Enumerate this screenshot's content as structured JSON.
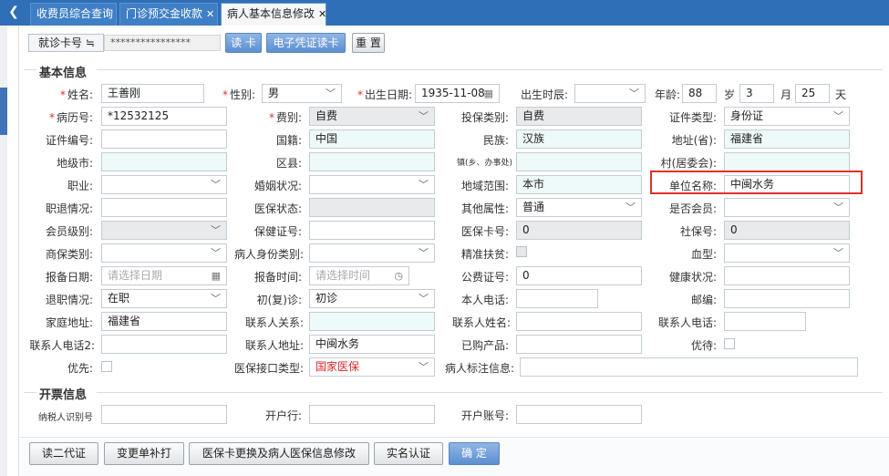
{
  "tabs": [
    {
      "label": "收费员综合查询",
      "closable": false,
      "active": false
    },
    {
      "label": "门诊预交金收款",
      "closable": true,
      "active": false
    },
    {
      "label": "病人基本信息修改",
      "closable": true,
      "active": true
    }
  ],
  "card": {
    "label": "就诊卡号 ≒",
    "value": "****************",
    "read_btn": "读 卡",
    "ecard_btn": "电子凭证读卡",
    "reset_btn": "重 置"
  },
  "sections": {
    "basic": "基本信息",
    "invoice": "开票信息"
  },
  "fields": {
    "name": {
      "label": "姓名:",
      "value": "王善刚"
    },
    "sex": {
      "label": "性别:",
      "value": "男"
    },
    "dob": {
      "label": "出生日期:",
      "value": "1935-11-08"
    },
    "birth_time": {
      "label": "出生时辰:",
      "value": ""
    },
    "age": {
      "label": "年龄:",
      "years": "88",
      "yl": "岁",
      "months": "3",
      "ml": "月",
      "days": "25",
      "dl": "天"
    },
    "record_no": {
      "label": "病历号:",
      "value": "*12532125"
    },
    "fee_type": {
      "label": "费别:",
      "value": "自费"
    },
    "ins_type": {
      "label": "投保类别:",
      "value": "自费"
    },
    "cert_type": {
      "label": "证件类型:",
      "value": "身份证"
    },
    "cert_no": {
      "label": "证件编号:",
      "value": ""
    },
    "nationality": {
      "label": "国籍:",
      "value": "中国"
    },
    "ethnic": {
      "label": "民族:",
      "value": "汉族"
    },
    "province": {
      "label": "地址(省):",
      "value": "福建省"
    },
    "city": {
      "label": "地级市:",
      "value": ""
    },
    "county": {
      "label": "区县:",
      "value": ""
    },
    "town": {
      "label": "镇(乡、办事处)",
      "value": ""
    },
    "village": {
      "label": "村(居委会):",
      "value": ""
    },
    "job": {
      "label": "职业:",
      "value": ""
    },
    "marital": {
      "label": "婚姻状况:",
      "value": ""
    },
    "region": {
      "label": "地域范围:",
      "value": "本市"
    },
    "employer": {
      "label": "单位名称:",
      "value": "中闽水务"
    },
    "title": {
      "label": "职退情况:",
      "value": ""
    },
    "ins_status": {
      "label": "医保状态:",
      "value": ""
    },
    "other_attr": {
      "label": "其他属性:",
      "value": "普通"
    },
    "is_member": {
      "label": "是否会员:",
      "value": ""
    },
    "member_level": {
      "label": "会员级别:",
      "value": ""
    },
    "health_no": {
      "label": "保健证号:",
      "value": ""
    },
    "ins_card": {
      "label": "医保卡号:",
      "value": "0"
    },
    "ss_no": {
      "label": "社保号:",
      "value": "0"
    },
    "comm_ins": {
      "label": "商保类别:",
      "value": ""
    },
    "patient_id_type": {
      "label": "病人身份类别:",
      "value": ""
    },
    "poverty": {
      "label": "精准扶贫:"
    },
    "blood": {
      "label": "血型:",
      "value": ""
    },
    "report_date": {
      "label": "报备日期:",
      "placeholder": "请选择日期"
    },
    "report_time": {
      "label": "报备时间:",
      "placeholder": "请选择时间"
    },
    "public_no": {
      "label": "公费证号:",
      "value": "0"
    },
    "health_status": {
      "label": "健康状况:",
      "value": ""
    },
    "retire": {
      "label": "退职情况:",
      "value": "在职"
    },
    "visit_type": {
      "label": "初(复)诊:",
      "value": "初诊"
    },
    "phone": {
      "label": "本人电话:",
      "value": ""
    },
    "zip": {
      "label": "邮编:",
      "value": ""
    },
    "home_addr": {
      "label": "家庭地址:",
      "value": "福建省"
    },
    "contact_rel": {
      "label": "联系人关系:",
      "value": ""
    },
    "contact_name": {
      "label": "联系人姓名:",
      "value": ""
    },
    "contact_phone": {
      "label": "联系人电话:",
      "value": ""
    },
    "contact_phone2": {
      "label": "联系人电话2:",
      "value": ""
    },
    "contact_addr": {
      "label": "联系人地址:",
      "value": "中闽水务"
    },
    "bought": {
      "label": "已购产品:",
      "value": ""
    },
    "vip": {
      "label": "优待:"
    },
    "priority": {
      "label": "优先:"
    },
    "ins_iface": {
      "label": "医保接口类型:",
      "value": "国家医保"
    },
    "patient_tag": {
      "label": "病人标注信息:",
      "value": ""
    },
    "taxpayer": {
      "label": "纳税人识别号",
      "value": ""
    },
    "bank": {
      "label": "开户行:",
      "value": ""
    },
    "account": {
      "label": "开户账号:",
      "value": ""
    }
  },
  "buttons": {
    "read_id": "读二代证",
    "change_note": "变更单补打",
    "ins_change": "医保卡更换及病人医保信息修改",
    "real_name": "实名认证",
    "confirm": "确 定"
  },
  "colors": {
    "topbar": "#2f6fb8",
    "required": "#e0302a",
    "highlight": "#e0302a"
  }
}
